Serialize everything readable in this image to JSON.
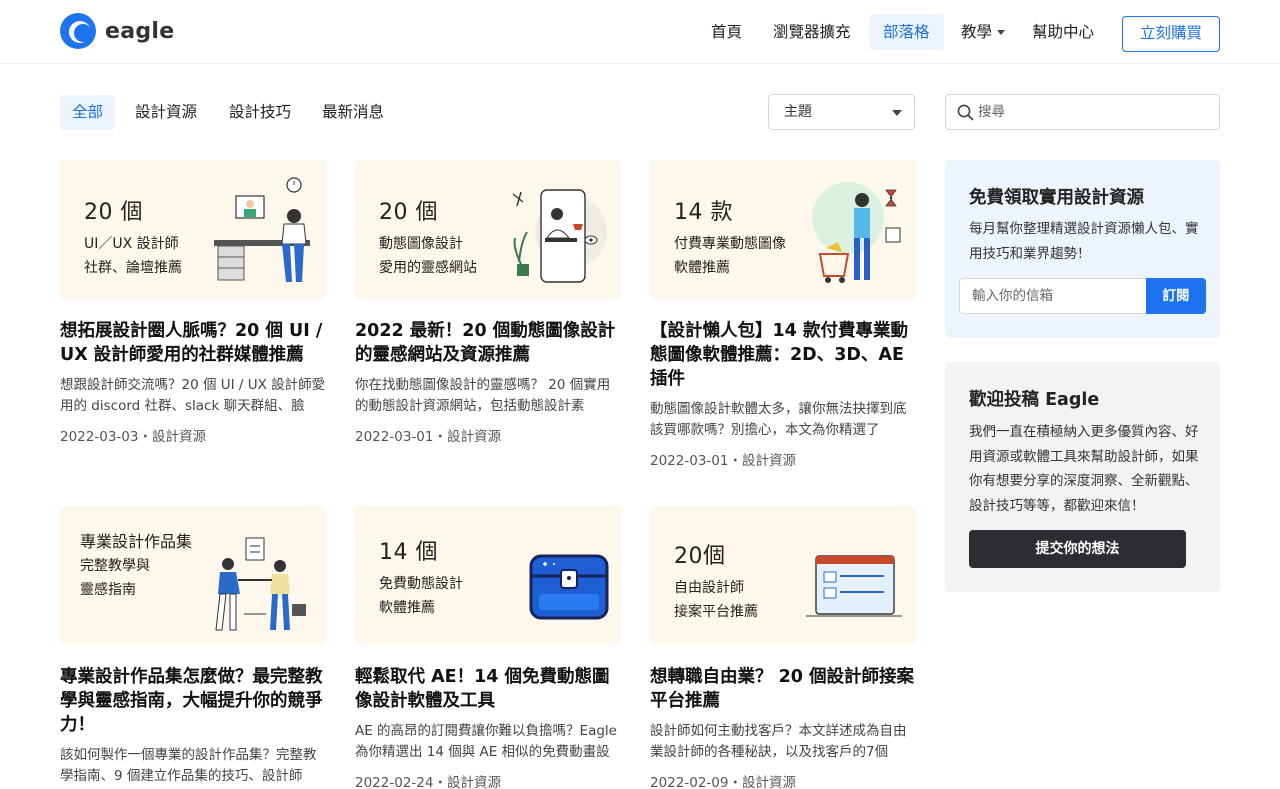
{
  "header": {
    "logo_text": "eagle",
    "nav": [
      {
        "label": "首頁"
      },
      {
        "label": "瀏覽器擴充"
      },
      {
        "label": "部落格"
      },
      {
        "label": "教學"
      },
      {
        "label": "幫助中心"
      }
    ],
    "buy_label": "立刻購買"
  },
  "filters": {
    "tabs": [
      {
        "label": "全部"
      },
      {
        "label": "設計資源"
      },
      {
        "label": "設計技巧"
      },
      {
        "label": "最新消息"
      }
    ],
    "topic_select": "主題",
    "search_placeholder": "搜尋"
  },
  "posts": [
    {
      "thumb_big": "20 個",
      "thumb_lines": [
        "UI／UX 設計師",
        "社群、論壇推薦"
      ],
      "title": "想拓展設計圈人脈嗎？20 個 UI / UX 設計師愛用的社群媒體推薦",
      "desc": "想跟設計師交流嗎？20 個 UI / UX 設計師愛用的 discord 社群、slack 聊天群組、臉",
      "meta": "2022-03-03・設計資源",
      "icon": "desk-illustration-icon"
    },
    {
      "thumb_big": "20 個",
      "thumb_lines": [
        "動態圖像設計",
        "愛用的靈感網站"
      ],
      "title": "2022 最新！20 個動態圖像設計的靈感網站及資源推薦",
      "desc": "你在找動態圖像設計的靈感嗎？ 20 個實用的動態設計資源網站，包括動態設計素",
      "meta": "2022-03-01・設計資源",
      "icon": "phone-illustration-icon"
    },
    {
      "thumb_big": "14 款",
      "thumb_lines": [
        "付費專業動態圖像",
        "軟體推薦"
      ],
      "title": "【設計懶人包】14 款付費專業動態圖像軟體推薦：2D、3D、AE 插件",
      "desc": "動態圖像設計軟體太多，讓你無法抉擇到底該買哪款嗎？別擔心，本文為你精選了",
      "meta": "2022-03-01・設計資源",
      "icon": "shopper-illustration-icon"
    },
    {
      "thumb_big": "",
      "thumb_lines": [
        "專業設計作品集",
        "完整教學與",
        "靈感指南"
      ],
      "title": "專業設計作品集怎麼做？最完整教學與靈感指南，大幅提升你的競爭力！",
      "desc": "該如何製作一個專業的設計作品集？完整教學指南、9 個建立作品集的技巧、設計師",
      "meta": "",
      "icon": "handshake-illustration-icon"
    },
    {
      "thumb_big": "14 個",
      "thumb_lines": [
        "免費動態設計",
        "軟體推薦"
      ],
      "title": "輕鬆取代 AE！14 個免費動態圖像設計軟體及工具",
      "desc": "AE 的高昂的訂閱費讓你難以負擔嗎？Eagle 為你精選出 14 個與 AE 相似的免費動畫設",
      "meta": "2022-02-24・設計資源",
      "icon": "treasure-chest-icon"
    },
    {
      "thumb_big": "20個",
      "thumb_lines": [
        "自由設計師",
        "接案平台推薦"
      ],
      "title": "想轉職自由業？ 20 個設計師接案平台推薦",
      "desc": "設計師如何主動找客戶？本文詳述成為自由業設計師的各種秘訣，以及找客戶的7個",
      "meta": "2022-02-09・設計資源",
      "icon": "browser-window-icon"
    }
  ],
  "sidebar": {
    "subscribe": {
      "title": "免費領取實用設計資源",
      "text": "每月幫你整理精選設計資源懶人包、實用技巧和業界趨勢！",
      "email_placeholder": "輸入你的信箱",
      "button": "訂閱"
    },
    "contribute": {
      "title": "歡迎投稿 Eagle",
      "text": "我們一直在積極納入更多優質內容、好用資源或軟體工具來幫助設計師，如果你有想要分享的深度洞察、全新觀點、設計技巧等等，都歡迎來信！",
      "button": "提交你的想法"
    }
  },
  "colors": {
    "accent": "#1e74f0",
    "thumb_bg": "#fef8ec"
  }
}
